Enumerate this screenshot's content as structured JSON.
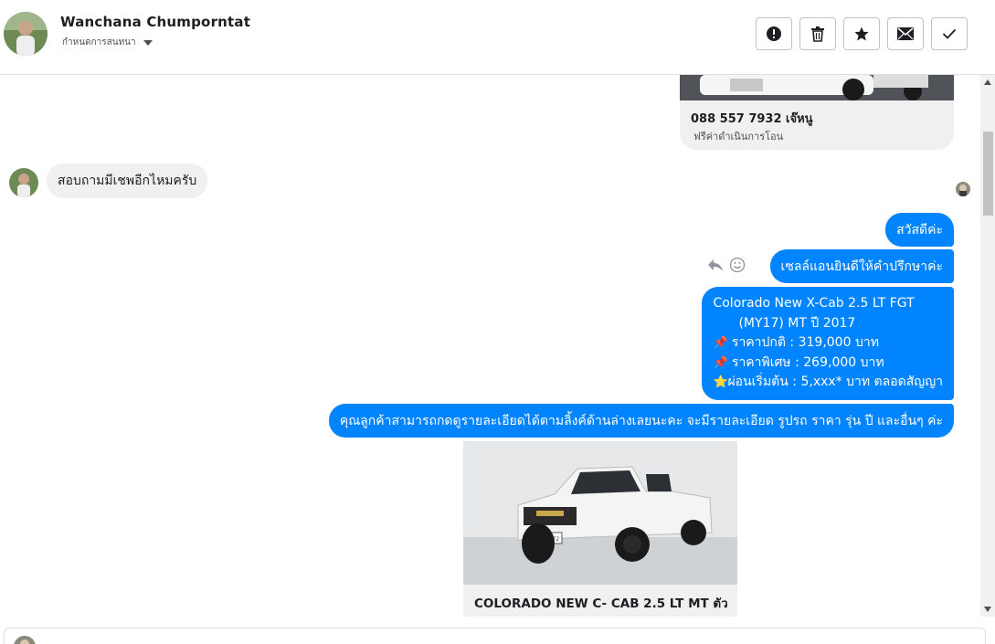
{
  "header": {
    "contact_name": "Wanchana Chumporntat",
    "assign_label": "กำหนดการสนทนา",
    "buttons": [
      {
        "name": "mark-spam-button",
        "icon": "alert-icon"
      },
      {
        "name": "delete-button",
        "icon": "trash-icon"
      },
      {
        "name": "star-button",
        "icon": "star-icon"
      },
      {
        "name": "mark-unread-button",
        "icon": "envelope-icon"
      },
      {
        "name": "mark-done-button",
        "icon": "check-icon"
      }
    ]
  },
  "messages": {
    "top_card": {
      "title": "088 557 7932 เจ๊หนู",
      "subtitle": "ฟรีค่าดำเนินการโอน"
    },
    "incoming_1": "สอบถามมีเชพอีกไหมครับ",
    "outgoing_1": "สวัสดีค่ะ",
    "outgoing_2": "เซลล์แอนยินดีให้คำปรึกษาค่ะ",
    "outgoing_3": {
      "line1": "Colorado New X-Cab 2.5 LT FGT",
      "line2": "(MY17) MT ปี 2017",
      "line3": "ราคาปกติ : 319,000 บาท",
      "line4": "ราคาพิเศษ : 269,000 บาท",
      "line5": "ผ่อนเริ่มต้น : 5,xxx* บาท ตลอดสัญญา",
      "pin_emoji": "📌",
      "star_emoji": "⭐"
    },
    "outgoing_4": "คุณลูกค้าสามารถกดดูรายละเอียดได้ตามลิ้งค์ด้านล่างเลยนะคะ จะมีรายละเอียด รูปรถ ราคา รุ่น ปี และอื่นๆ ค่ะ",
    "bottom_card": {
      "title": "COLORADO NEW C- CAB 2.5 LT MT ตัว",
      "plate": "กจ 0172"
    }
  },
  "colors": {
    "outgoing_bubble": "#0084ff",
    "incoming_bubble": "#f1f0f0",
    "text": "#1c1e21"
  }
}
